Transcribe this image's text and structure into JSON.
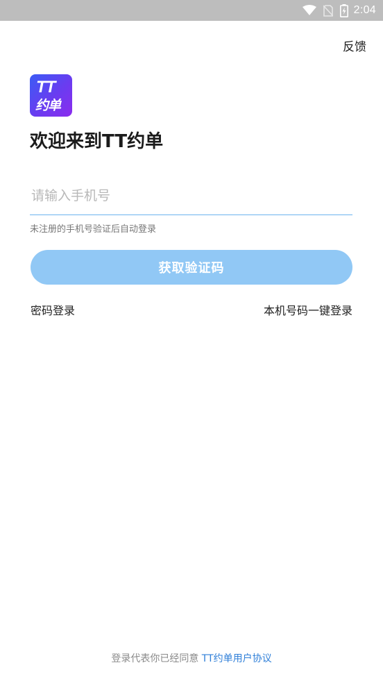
{
  "status_bar": {
    "time": "2:04",
    "icons": [
      "wifi-icon",
      "no-sim-icon",
      "battery-charging-icon"
    ]
  },
  "header": {
    "feedback_label": "反馈"
  },
  "logo": {
    "line1": "TT",
    "line2": "约单"
  },
  "welcome_title": "欢迎来到TT约单",
  "phone": {
    "value": "",
    "placeholder": "请输入手机号"
  },
  "hint_text": "未注册的手机号验证后自动登录",
  "get_code_label": "获取验证码",
  "links": {
    "password_login": "密码登录",
    "one_click_login": "本机号码一键登录"
  },
  "footer": {
    "prefix": "登录代表你已经同意 ",
    "agreement_link": "TT约单用户协议"
  },
  "colors": {
    "accent": "#2f7fd8",
    "button_disabled": "#91c8f5",
    "input_underline": "#6cb4ee",
    "status_bar": "#bdbdbd"
  }
}
